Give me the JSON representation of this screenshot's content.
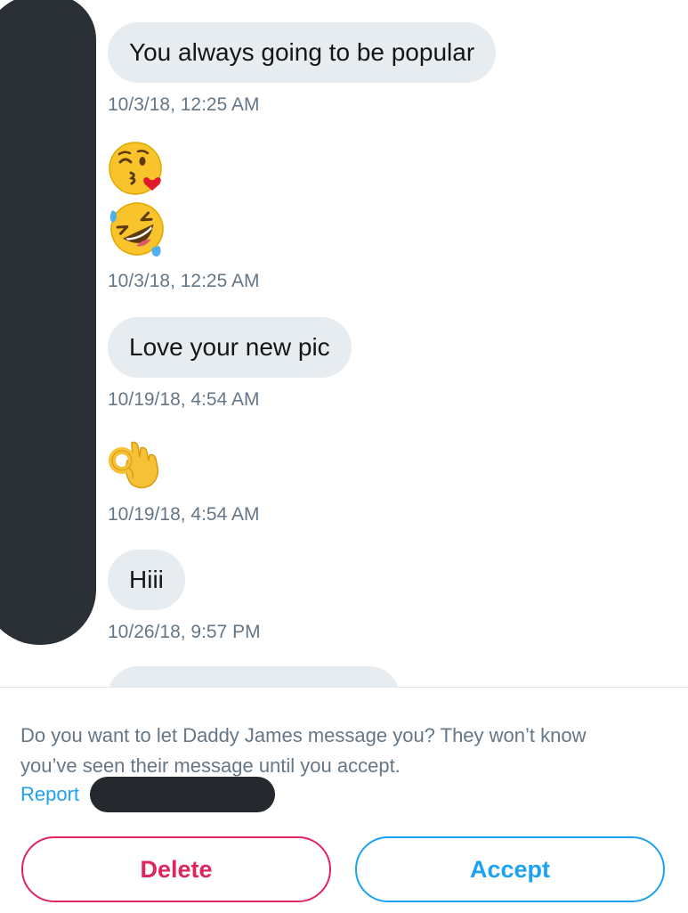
{
  "conversation": {
    "messages": [
      {
        "text": "You always going to be popular",
        "timestamp": "10/3/18, 12:25 AM"
      },
      {
        "emojis": [
          "face-throwing-kiss-emoji",
          "rolling-on-floor-laughing-emoji"
        ],
        "timestamp": "10/3/18, 12:25 AM"
      },
      {
        "text": "Love your new pic",
        "timestamp": "10/19/18, 4:54 AM"
      },
      {
        "emojis": [
          "ok-hand-emoji"
        ],
        "timestamp": "10/19/18, 4:54 AM"
      },
      {
        "text": "Hiii",
        "timestamp": "10/26/18, 9:57 PM"
      }
    ]
  },
  "request_panel": {
    "prompt": "Do you want to let Daddy James message you? They won’t know you’ve seen their message until you accept.",
    "report_label": "Report",
    "delete_label": "Delete",
    "accept_label": "Accept"
  },
  "colors": {
    "bubble_background": "#e6ecf0",
    "timestamp_text": "#657786",
    "link_blue": "#1da1f2",
    "delete_red": "#e0245e",
    "redaction": "#2b3036"
  }
}
